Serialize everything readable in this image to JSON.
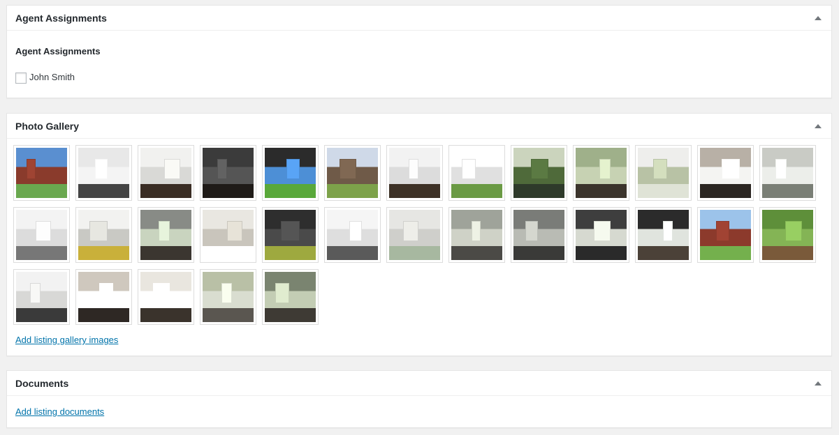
{
  "agent_box": {
    "title": "Agent Assignments",
    "subtitle": "Agent Assignments",
    "agents": [
      {
        "name": "John Smith",
        "checked": false
      }
    ],
    "toggle_icon": "arrow-up-icon"
  },
  "gallery_box": {
    "title": "Photo Gallery",
    "add_link": "Add listing gallery images",
    "toggle_icon": "arrow-up-icon",
    "photos": [
      {
        "subject": "brick house exterior",
        "palette": [
          "#5a8fd0",
          "#8a3b2c",
          "#6aa84f"
        ]
      },
      {
        "subject": "kitchen",
        "palette": [
          "#e8e8e8",
          "#f4f4f4",
          "#444444"
        ]
      },
      {
        "subject": "living room fireplace",
        "palette": [
          "#f1f1ef",
          "#d9d9d6",
          "#3a2d24"
        ]
      },
      {
        "subject": "dark room",
        "palette": [
          "#3b3b3b",
          "#555555",
          "#1f1b18"
        ]
      },
      {
        "subject": "front door view to lawn",
        "palette": [
          "#2b2b2b",
          "#4d8fd6",
          "#59a83a"
        ]
      },
      {
        "subject": "house behind trees",
        "palette": [
          "#cfd9e8",
          "#6f5a48",
          "#7da24a"
        ]
      },
      {
        "subject": "room with fan and fireplace",
        "palette": [
          "#f2f2f2",
          "#dcdcdc",
          "#3d3126"
        ]
      },
      {
        "subject": "kitchen cabinets",
        "palette": [
          "#ffffff",
          "#e0e0e0",
          "#6a9a44"
        ]
      },
      {
        "subject": "dining with windows",
        "palette": [
          "#cbd4bd",
          "#4f6a3a",
          "#2e3a2a"
        ]
      },
      {
        "subject": "green room chandelier",
        "palette": [
          "#9fb08a",
          "#c7d2b3",
          "#3b342c"
        ]
      },
      {
        "subject": "white bathroom",
        "palette": [
          "#eeeeec",
          "#b8c2a5",
          "#dfe3d6"
        ]
      },
      {
        "subject": "tub bathroom",
        "palette": [
          "#b8b0a6",
          "#f4f4f2",
          "#2b2622"
        ]
      },
      {
        "subject": "bathroom shower",
        "palette": [
          "#c9cbc5",
          "#eceeea",
          "#7a7f76"
        ]
      },
      {
        "subject": "bathroom vanity",
        "palette": [
          "#f3f3f3",
          "#dcdcdc",
          "#777777"
        ]
      },
      {
        "subject": "hallway flowers",
        "palette": [
          "#f2f2f0",
          "#c9c9c4",
          "#c9b03a"
        ]
      },
      {
        "subject": "room with windows",
        "palette": [
          "#888b86",
          "#c9d4bf",
          "#3b3630"
        ]
      },
      {
        "subject": "laundry nook",
        "palette": [
          "#e9e7e1",
          "#c9c5bc",
          "#ffffff"
        ]
      },
      {
        "subject": "entry door dark",
        "palette": [
          "#2e2e2e",
          "#4a4a4a",
          "#9ea93f"
        ]
      },
      {
        "subject": "bathroom sink",
        "palette": [
          "#f5f5f5",
          "#dedede",
          "#5a5a5a"
        ]
      },
      {
        "subject": "arched window closet",
        "palette": [
          "#e6e6e3",
          "#cfcfcb",
          "#a7b8a0"
        ]
      },
      {
        "subject": "empty room",
        "palette": [
          "#9fa39a",
          "#cfd2c7",
          "#4b4a46"
        ]
      },
      {
        "subject": "doorways",
        "palette": [
          "#7a7c78",
          "#b9bbb4",
          "#3a3a38"
        ]
      },
      {
        "subject": "bay windows dark",
        "palette": [
          "#3e3e3e",
          "#d6d9d0",
          "#2a2a2a"
        ]
      },
      {
        "subject": "front entry interior",
        "palette": [
          "#2b2b2b",
          "#e0e4de",
          "#4b4138"
        ]
      },
      {
        "subject": "brick house lawn",
        "palette": [
          "#9cc3ea",
          "#8c3a2c",
          "#74b04d"
        ]
      },
      {
        "subject": "backyard trees",
        "palette": [
          "#5e8f3a",
          "#84b455",
          "#7a5a3a"
        ]
      },
      {
        "subject": "two story living room",
        "palette": [
          "#f2f2f2",
          "#d8d8d6",
          "#3a3a3a"
        ]
      },
      {
        "subject": "kitchen column",
        "palette": [
          "#cfc8be",
          "#ffffff",
          "#2e2824"
        ]
      },
      {
        "subject": "kitchen island",
        "palette": [
          "#e9e6df",
          "#ffffff",
          "#3a332c"
        ]
      },
      {
        "subject": "green empty room",
        "palette": [
          "#b9c0a6",
          "#d9ddd0",
          "#5a5650"
        ]
      },
      {
        "subject": "bay window room",
        "palette": [
          "#7a8470",
          "#c3cdb4",
          "#3e3a34"
        ]
      }
    ]
  },
  "documents_box": {
    "title": "Documents",
    "add_link": "Add listing documents",
    "toggle_icon": "arrow-up-icon"
  }
}
